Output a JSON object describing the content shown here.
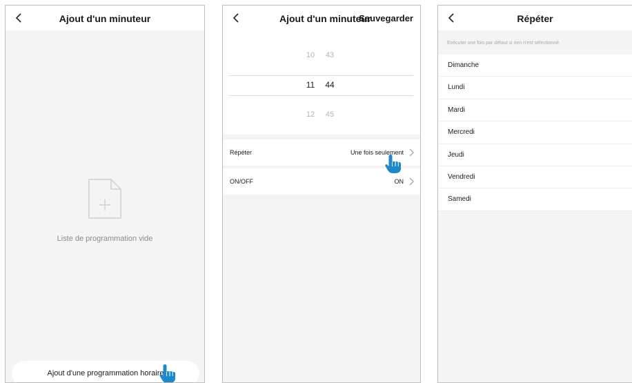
{
  "screen1": {
    "title": "Ajout d'un minuteur",
    "empty_text": "Liste de programmation vide",
    "add_button": "Ajout d'une programmation horaire"
  },
  "screen2": {
    "title": "Ajout d'un minuteur",
    "save_label": "Sauvegarder",
    "picker": {
      "rows": [
        {
          "hour": "10",
          "minute": "43"
        },
        {
          "hour": "11",
          "minute": "44"
        },
        {
          "hour": "12",
          "minute": "45"
        }
      ],
      "selected_index": 1
    },
    "repeat": {
      "label": "Répéter",
      "value": "Une fois seulement"
    },
    "onoff": {
      "label": "ON/OFF",
      "value": "ON"
    }
  },
  "screen3": {
    "title": "Répéter",
    "hint": "Exécuter une fois par défaut si rien n'est sélectionné",
    "days": [
      "Dimanche",
      "Lundi",
      "Mardi",
      "Mercredi",
      "Jeudi",
      "Vendredi",
      "Samedi"
    ]
  },
  "colors": {
    "background": "#f4f4f4",
    "surface": "#ffffff",
    "hand_cursor": "#1e88c8",
    "muted_text": "#8a8a8a"
  },
  "icons": [
    "back-arrow-icon",
    "add-file-icon",
    "chevron-right-icon",
    "pointing-hand-icon"
  ]
}
